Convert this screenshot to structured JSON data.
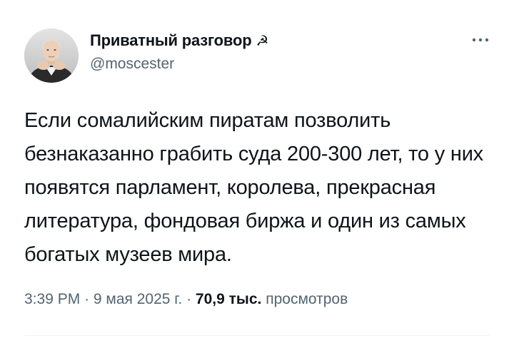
{
  "author": {
    "display_name": "Приватный разговор",
    "name_emoji": "☭",
    "handle": "@moscester"
  },
  "tweet": {
    "text": "Если сомалийским пиратам позволить безнаказанно грабить суда 200-300 лет, то у них появятся парламент, королева, прекрасная литература, фондовая биржа и один из самых богатых музеев мира."
  },
  "meta": {
    "time": "3:39 PM",
    "date": "9 мая 2025 г.",
    "separator": "·",
    "views_count": "70,9 тыс.",
    "views_label": "просмотров"
  },
  "icons": {
    "more": "more-horizontal-icon",
    "avatar": "profile-photo"
  },
  "colors": {
    "text_primary": "#0f1419",
    "text_secondary": "#536471",
    "divider": "#eff3f4"
  }
}
